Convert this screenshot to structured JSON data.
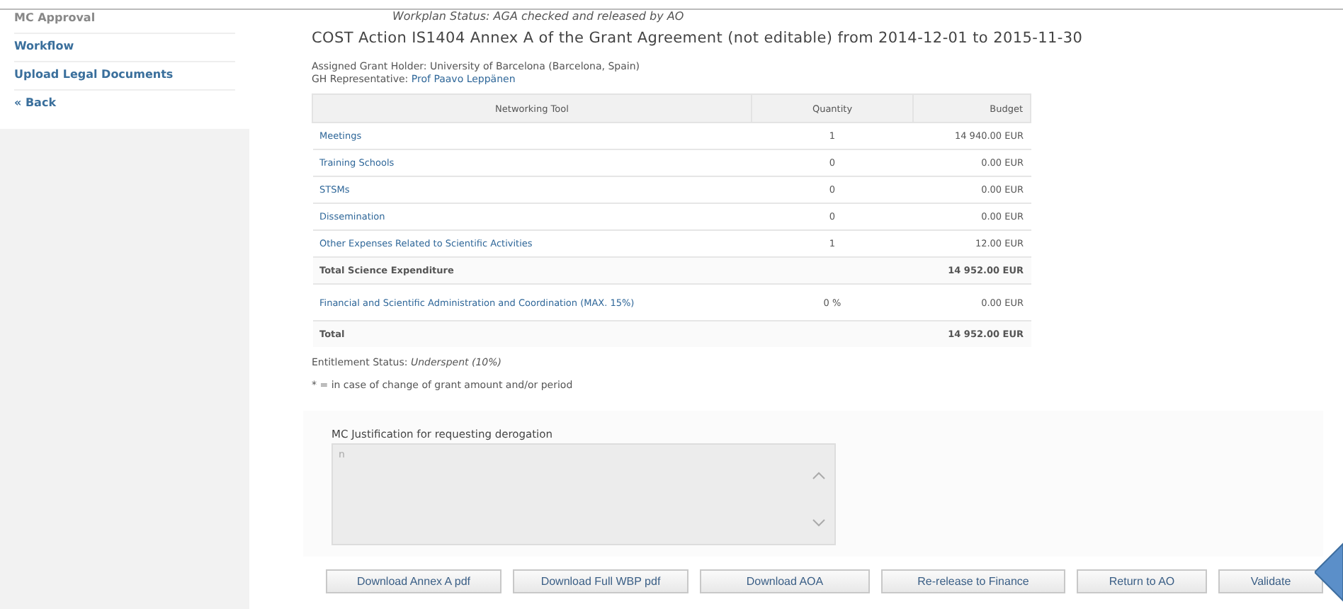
{
  "sidebar": {
    "items": [
      {
        "label": "MC Approval"
      },
      {
        "label": "Workflow"
      },
      {
        "label": "Upload Legal Documents"
      },
      {
        "label": "« Back"
      }
    ]
  },
  "workplan_status": "Workplan Status: AGA checked and released by AO",
  "title": "COST Action IS1404 Annex A of the Grant Agreement (not editable) from 2014-12-01 to 2015-11-30",
  "grant_holder": "Assigned Grant Holder: University of Barcelona (Barcelona, Spain)",
  "gh_representative": {
    "label": "GH Representative:",
    "name": "Prof Paavo Leppänen"
  },
  "table": {
    "columns": [
      "Networking Tool",
      "Quantity",
      "Budget"
    ],
    "rows": [
      {
        "kind": "link",
        "tool": "Meetings",
        "quantity": "1",
        "budget": "14 940.00 EUR"
      },
      {
        "kind": "link",
        "tool": "Training Schools",
        "quantity": "0",
        "budget": "0.00 EUR"
      },
      {
        "kind": "link",
        "tool": "STSMs",
        "quantity": "0",
        "budget": "0.00 EUR"
      },
      {
        "kind": "link",
        "tool": "Dissemination",
        "quantity": "0",
        "budget": "0.00 EUR"
      },
      {
        "kind": "link",
        "tool": "Other Expenses Related to Scientific Activities",
        "quantity": "1",
        "budget": "12.00 EUR"
      },
      {
        "kind": "total",
        "tool": "Total Science Expenditure",
        "budget": "14 952.00 EUR"
      },
      {
        "kind": "link",
        "tool": "Financial and Scientific Administration and Coordination (MAX. 15%)",
        "quantity": "0 %",
        "budget": "0.00 EUR"
      },
      {
        "kind": "total",
        "tool": "Total",
        "budget": "14 952.00 EUR"
      }
    ]
  },
  "entitlement": {
    "label": "Entitlement Status:",
    "value": "Underspent (10%)"
  },
  "note": "* = in case of change of grant amount and/or period",
  "justification": {
    "label": "MC Justification for requesting derogation",
    "value": "n"
  },
  "buttons": [
    "Download Annex A pdf",
    "Download Full WBP pdf",
    "Download AOA",
    "Re-release to Finance",
    "Return to AO",
    "Validate"
  ]
}
